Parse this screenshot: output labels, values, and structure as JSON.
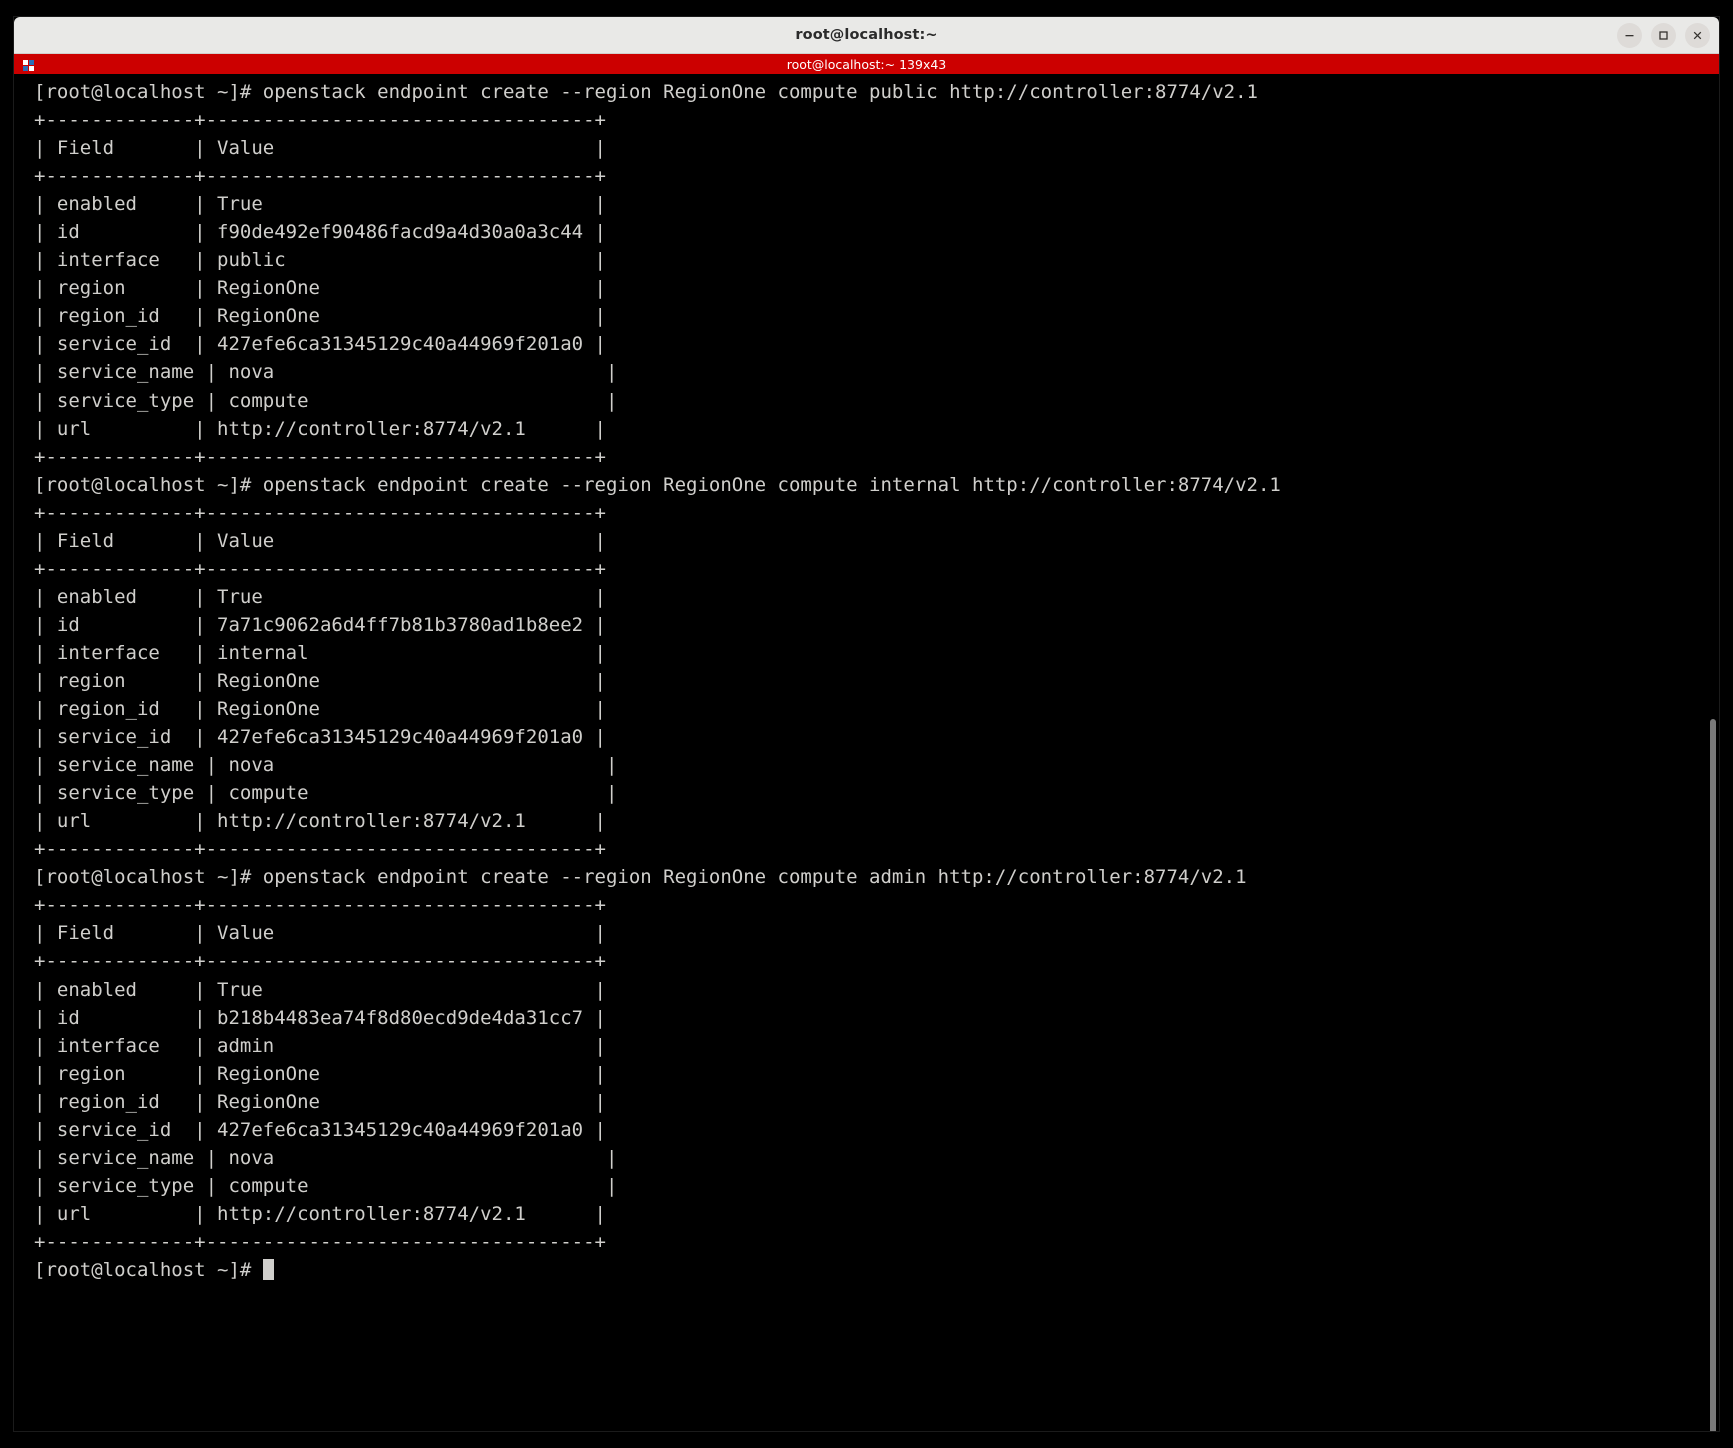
{
  "window": {
    "title": "root@localhost:~",
    "controls": [
      {
        "name": "minimize-button",
        "glyph": "–"
      },
      {
        "name": "maximize-button",
        "glyph": "□"
      },
      {
        "name": "close-button",
        "glyph": "✕"
      }
    ]
  },
  "tab": {
    "label": "root@localhost:~ 139x43",
    "icon": "terminal-icon",
    "bg_color": "#cc0000",
    "fg_color": "#ffffff"
  },
  "terminal": {
    "columns": 139,
    "rows": 43,
    "background_color": "#000000",
    "foreground_color": "#d0cfcc",
    "prompt": "[root@localhost ~]#",
    "cursor": "block",
    "commands": [
      "openstack endpoint create --region RegionOne compute public http://controller:8774/v2.1",
      "openstack endpoint create --region RegionOne compute internal http://controller:8774/v2.1",
      "openstack endpoint create --region RegionOne compute admin http://controller:8774/v2.1"
    ],
    "table_headers": [
      "Field",
      "Value"
    ],
    "table_rule": "+-------------+----------------------------------+",
    "endpoints": [
      {
        "enabled": "True",
        "id": "f90de492ef90486facd9a4d30a0a3c44",
        "interface": "public",
        "region": "RegionOne",
        "region_id": "RegionOne",
        "service_id": "427efe6ca31345129c40a44969f201a0",
        "service_name": "nova",
        "service_type": "compute",
        "url": "http://controller:8774/v2.1"
      },
      {
        "enabled": "True",
        "id": "7a71c9062a6d4ff7b81b3780ad1b8ee2",
        "interface": "internal",
        "region": "RegionOne",
        "region_id": "RegionOne",
        "service_id": "427efe6ca31345129c40a44969f201a0",
        "service_name": "nova",
        "service_type": "compute",
        "url": "http://controller:8774/v2.1"
      },
      {
        "enabled": "True",
        "id": "b218b4483ea74f8d80ecd9de4da31cc7",
        "interface": "admin",
        "region": "RegionOne",
        "region_id": "RegionOne",
        "service_id": "427efe6ca31345129c40a44969f201a0",
        "service_name": "nova",
        "service_type": "compute",
        "url": "http://controller:8774/v2.1"
      }
    ],
    "screen_text": ""
  }
}
